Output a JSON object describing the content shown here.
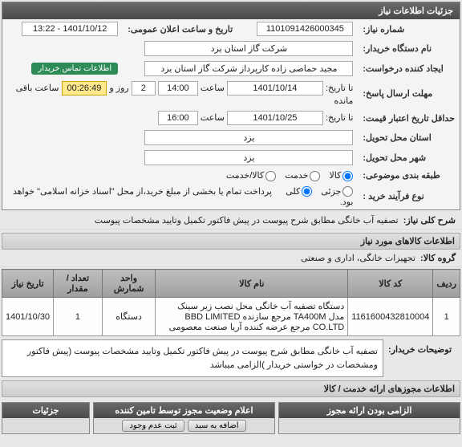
{
  "header": {
    "title": "جزئیات اطلاعات نیاز"
  },
  "form": {
    "need_no_label": "شماره نیاز:",
    "need_no": "1101091426000345",
    "announce_label": "تاریخ و ساعت اعلان عمومی:",
    "announce_value": "1401/10/12 - 13:22",
    "buyer_label": "نام دستگاه خریدار:",
    "buyer_value": "شرکت گاز استان یزد",
    "requester_label": "ایجاد کننده درخواست:",
    "requester_value": "مجید حماصی زاده کارپرداز شرکت گاز استان یزد",
    "contact_badge": "اطلاعات تماس خریدار",
    "deadline_label": "مهلت ارسال پاسخ:",
    "deadline_to": "تا تاریخ:",
    "deadline_date": "1401/10/14",
    "time_word": "ساعت",
    "deadline_time": "14:00",
    "days": "2",
    "days_word": "روز و",
    "timer": "00:26:49",
    "timer_suffix": "ساعت باقی مانده",
    "validity_label": "حداقل تاریخ اعتبار قیمت:",
    "validity_to": "تا تاریخ:",
    "validity_date": "1401/10/25",
    "validity_time": "16:00",
    "delivery_state_label": "استان محل تحویل:",
    "delivery_state": "یزد",
    "delivery_city_label": "شهر محل تحویل:",
    "delivery_city": "یزد",
    "classify_label": "طبقه بندی موضوعی:",
    "opt_goods": "کالا",
    "opt_service": "خدمت",
    "opt_goods_service": "کالا/خدمت",
    "process_label": "نوع فرآیند خرید :",
    "opt_partial": "جزئی",
    "opt_all": "کلی",
    "process_note": "پرداخت تمام یا بخشی از مبلغ خرید،از محل \"اسناد خزانه اسلامی\" خواهد بود.",
    "summary_label": "شرح کلی نیاز:",
    "summary_value": "تصفیه آب خانگی مطابق شرح پیوست در پیش فاکتور تکمیل وتایید مشخصات پیوست"
  },
  "items_header": "اطلاعات کالاهای مورد نیاز",
  "group_label": "گروه کالا:",
  "group_value": "تجهیزات خانگی، اداری و صنعتی",
  "grid": {
    "cols": {
      "row": "ردیف",
      "code": "کد کالا",
      "name": "نام کالا",
      "unit": "واحد شمارش",
      "qty": "تعداد / مقدار",
      "need_date": "تاریخ نیاز"
    },
    "rows": [
      {
        "row": "1",
        "code": "1161600432810004",
        "name": "دستگاه تصفیه آب خانگی محل نصب زیر سینک مدل TA400M مرجع سازنده BBD LIMITED CO.LTD مرجع عرضه کننده آریا صنعت معصومی",
        "unit": "دستگاه",
        "qty": "1",
        "need_date": "1401/10/30"
      }
    ]
  },
  "buyer_note_label": "توضیحات خریدار:",
  "buyer_note": "تصفیه آب خانگی مطابق شرح پیوست در پیش فاکتور تکمیل وتایید مشخصات پیوست (پیش فاکتور ومشخصات در خواستی خریدار )الزامی میباشد",
  "licenses_header": "اطلاعات مجوزهای ارائه خدمت / کالا",
  "bottom": {
    "col1": "الزامی بودن ارائه مجوز",
    "col2": "اعلام وضعیت مجوز توسط تامین کننده",
    "col3": "جزئیات",
    "btn1": "اضافه به سبد",
    "btn2": "ثبت عدم وجود"
  }
}
